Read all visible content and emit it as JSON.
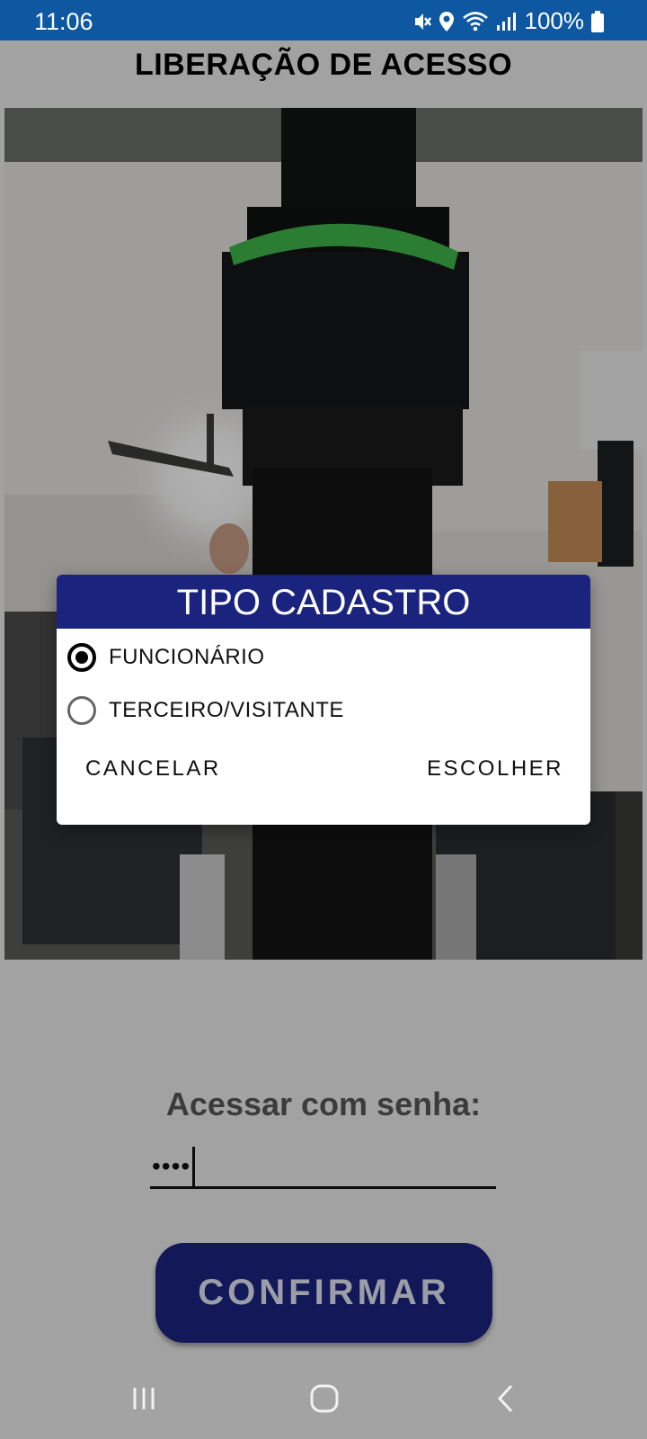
{
  "status_bar": {
    "time": "11:06",
    "battery": "100%",
    "icons": [
      "mute-vibrate-icon",
      "location-icon",
      "wifi-icon",
      "signal-icon",
      "battery-icon"
    ]
  },
  "app": {
    "title": "LIBERAÇÃO DE ACESSO",
    "password_label": "Acessar com senha:",
    "password_value": "••••",
    "confirm_label": "CONFIRMAR"
  },
  "dialog": {
    "title": "TIPO CADASTRO",
    "options": [
      {
        "label": "FUNCIONÁRIO",
        "selected": true
      },
      {
        "label": "TERCEIRO/VISITANTE",
        "selected": false
      }
    ],
    "cancel_label": "CANCELAR",
    "choose_label": "ESCOLHER"
  },
  "nav": {
    "icons": [
      "recent-apps-icon",
      "home-icon",
      "back-icon"
    ]
  },
  "colors": {
    "status_bar": "#0d58a1",
    "dialog_header": "#1a237e",
    "confirm_button": "#1a237e",
    "nav_bar": "#a3a3a3"
  }
}
